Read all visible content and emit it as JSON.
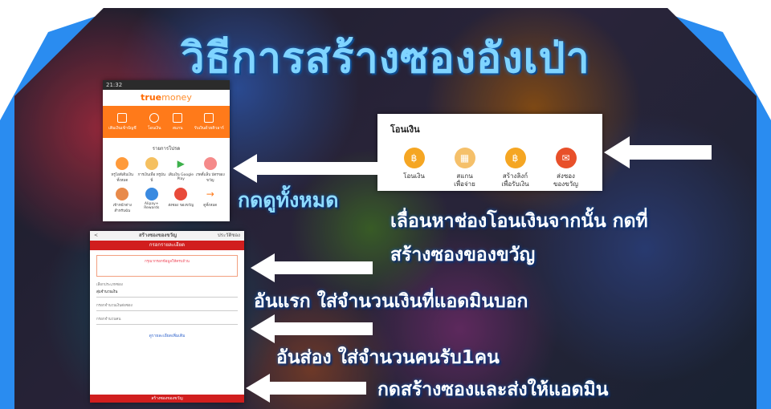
{
  "title": "วิธีการสร้างซองอังเป่า",
  "truemoney": {
    "status_time": "21:32",
    "brand_true": "true",
    "brand_money": "money",
    "top_items": [
      "เติมเงินเข้าบัญชี",
      "โอนเงิน",
      "สแกน",
      "รับเงินด้วยคิวอาร์"
    ],
    "section": "รายการโปรด",
    "grid_items": [
      "ทรูไอดีเติมเงิน ทั้งหมด",
      "การเงินเพื่อ ทรูมันนี่",
      "เติมเงิน Google Play",
      "เรดดี้แล็บ บัตรของขวัญ",
      "เข้าหน้าต่าง สำหรับฉัน",
      "Alipay+ Rewards",
      "ส่งซอง ของขวัญ",
      "ดูทั้งหมด"
    ]
  },
  "transfer": {
    "title": "โอนเงิน",
    "items": [
      "โอนเงิน",
      "สแกน\nเพื่อจ่าย",
      "สร้างลิงก์\nเพื่อรับเงิน",
      "ส่งซอง\nของขวัญ"
    ]
  },
  "form": {
    "back": "<",
    "header": "สร้างซองของขวัญ",
    "right": "ประวัติซอง",
    "red_bar": "กรอกรายละเอียด",
    "box_text": "กรุณากรอกข้อมูลให้ครบถ้วน",
    "field1": "เลือกประเภทซอง",
    "field1_value": "สุ่มจำนวนเงิน",
    "field2": "กรอกจำนวนเงินต่อซอง",
    "field3": "กรอกจำนวนคน",
    "link": "ดูรายละเอียดเพิ่มเติม",
    "footer": "สร้างซองของขวัญ"
  },
  "captions": {
    "view_all": "กดดูทั้งหมด",
    "line1": "เลื่อนหาช่องโอนเงินจากนั้น กดที่",
    "line2": "สร้างซองของขวัญ",
    "line3": "อันแรก ใส่จำนวนเงินที่แอดมินบอก",
    "line4": "อันส่อง ใส่จำนวนคนรับ1คน",
    "line5": "กดสร้างซองและส่งให้แอดมิน"
  },
  "colors": {
    "frame": "#2a8cf0",
    "accent_orange": "#ff7a1a",
    "title": "#7fd4ff"
  }
}
